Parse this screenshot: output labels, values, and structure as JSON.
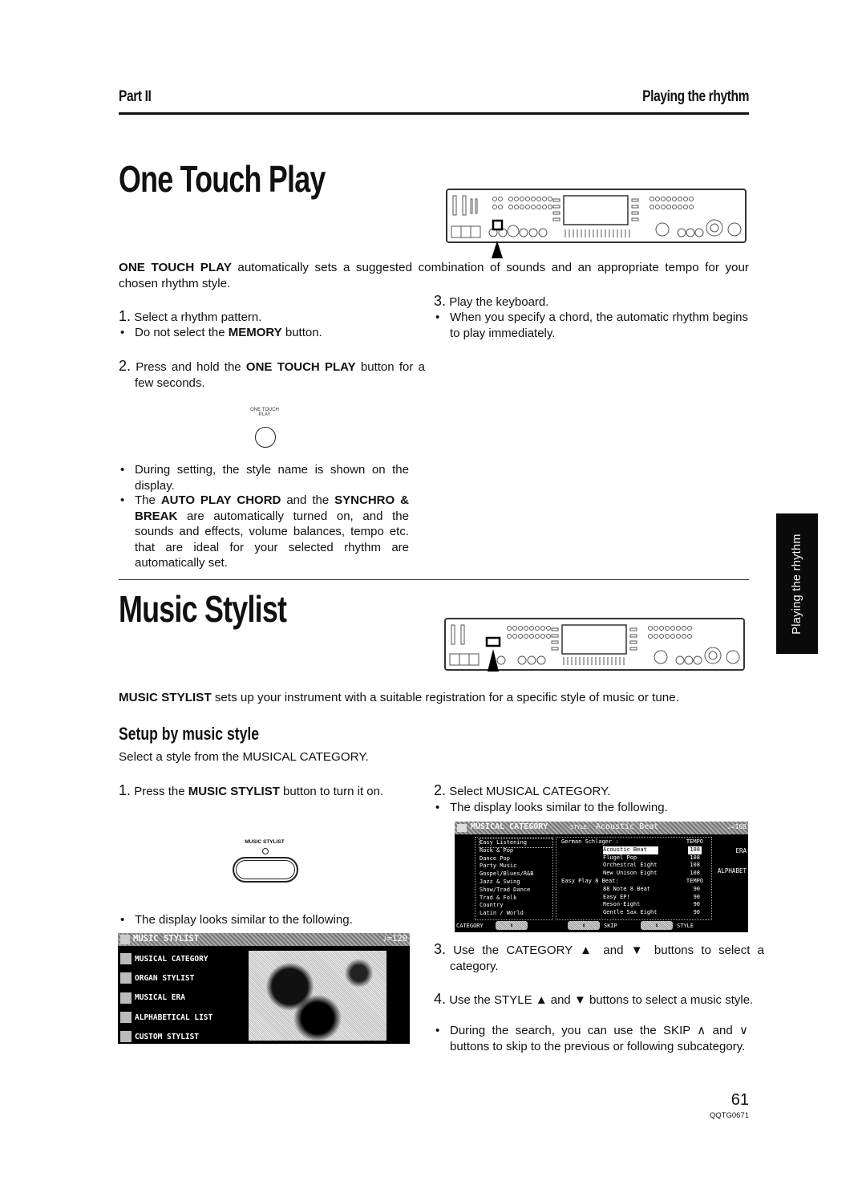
{
  "header": {
    "part": "Part II",
    "section": "Playing the rhythm"
  },
  "one_touch_play": {
    "title": "One Touch Play",
    "intro_bold": "ONE TOUCH PLAY",
    "intro_rest": " automatically sets a suggested combination of sounds and an appropriate tempo for your chosen rhythm style.",
    "step1_num": "1.",
    "step1": "Select a rhythm pattern.",
    "step1_bullet_pre": "Do not select the ",
    "step1_bullet_bold": "MEMORY",
    "step1_bullet_post": " button.",
    "step2_num": "2.",
    "step2_pre": "Press and hold the ",
    "step2_bold": "ONE TOUCH PLAY",
    "step2_post": " button for a few seconds.",
    "button_label_line1": "ONE TOUCH",
    "button_label_line2": "PLAY",
    "bullet_a": "During setting, the style name is shown on the display.",
    "bullet_b_pre": "The ",
    "bullet_b_bold1": "AUTO PLAY CHORD",
    "bullet_b_mid": " and the ",
    "bullet_b_bold2": "SYNCHRO & BREAK",
    "bullet_b_post": " are automatically turned on, and the sounds and effects, volume balances, tempo etc. that are ideal for your selected rhythm are automatically set.",
    "step3_num": "3.",
    "step3": "Play the keyboard.",
    "step3_bullet": "When you specify a chord, the automatic rhythm begins to play immediately."
  },
  "music_stylist": {
    "title": "Music Stylist",
    "intro_bold": "MUSIC STYLIST",
    "intro_rest": " sets up your instrument with a suitable registration for a specific style of music or tune.",
    "subtitle": "Setup by music style",
    "sub_intro": "Select a style from the MUSICAL CATEGORY.",
    "step1_num": "1.",
    "step1_pre": "Press the ",
    "step1_bold": "MUSIC STYLIST",
    "step1_post": " button to turn it on.",
    "button_label": "MUSIC STYLIST",
    "step1_bullet": "The display looks similar to the following.",
    "step2_num": "2.",
    "step2": "Select MUSICAL CATEGORY.",
    "step2_bullet": "The display looks similar to the following.",
    "step3_num": "3.",
    "step3": "Use the CATEGORY ▲ and ▼ buttons to select a category.",
    "step4_num": "4.",
    "step4": "Use the STYLE ▲ and ▼ buttons to select a music style.",
    "step4_bullet": "During the search, you can use the SKIP ∧ and ∨ buttons to skip to the previous or following subcategory."
  },
  "lcd_stylist": {
    "title": "MUSIC STYLIST",
    "tempo": "♩=120",
    "items": [
      "MUSICAL CATEGORY",
      "ORGAN STYLIST",
      "MUSICAL ERA",
      "ALPHABETICAL LIST",
      "CUSTOM STYLIST"
    ]
  },
  "lcd_category": {
    "title": "MUSICAL CATEGORY",
    "style_label": "STYLE:",
    "style_value": "Acoustic Beat",
    "tempo": "♩=108",
    "categories": [
      "Easy Listening",
      "Rock & Pop",
      "Dance Pop",
      "Party Music",
      "Gospel/Blues/R&B",
      "Jazz & Swing",
      "Show/Trad Dance",
      "Trad & Folk",
      "Country",
      "Latin / World"
    ],
    "selected_category": "Easy Listening",
    "groups": [
      {
        "name": "German Schlager :",
        "tempo_label": "TEMPO",
        "styles": [
          {
            "name": "Acoustic Beat",
            "tempo": "108",
            "selected": true
          },
          {
            "name": "Flugel Pop",
            "tempo": "108"
          },
          {
            "name": "Orchestral Eight",
            "tempo": "108"
          },
          {
            "name": "New Unison Eight",
            "tempo": "108"
          }
        ]
      },
      {
        "name": "Easy Play 8 Beat:",
        "tempo_label": "TEMPO",
        "styles": [
          {
            "name": "88 Note 8 Beat",
            "tempo": "90"
          },
          {
            "name": "Easy EP!",
            "tempo": "90"
          },
          {
            "name": "Reson-Eight",
            "tempo": "90"
          },
          {
            "name": "Gentle Sax Eight",
            "tempo": "90"
          }
        ]
      }
    ],
    "right_labels": [
      "ERA",
      "ALPHABET"
    ],
    "bottom": {
      "category": "CATEGORY",
      "skip": "SKIP",
      "style": "STYLE"
    }
  },
  "side_tab": "Playing the rhythm",
  "footer": {
    "page": "61",
    "code": "QQTG0671"
  }
}
